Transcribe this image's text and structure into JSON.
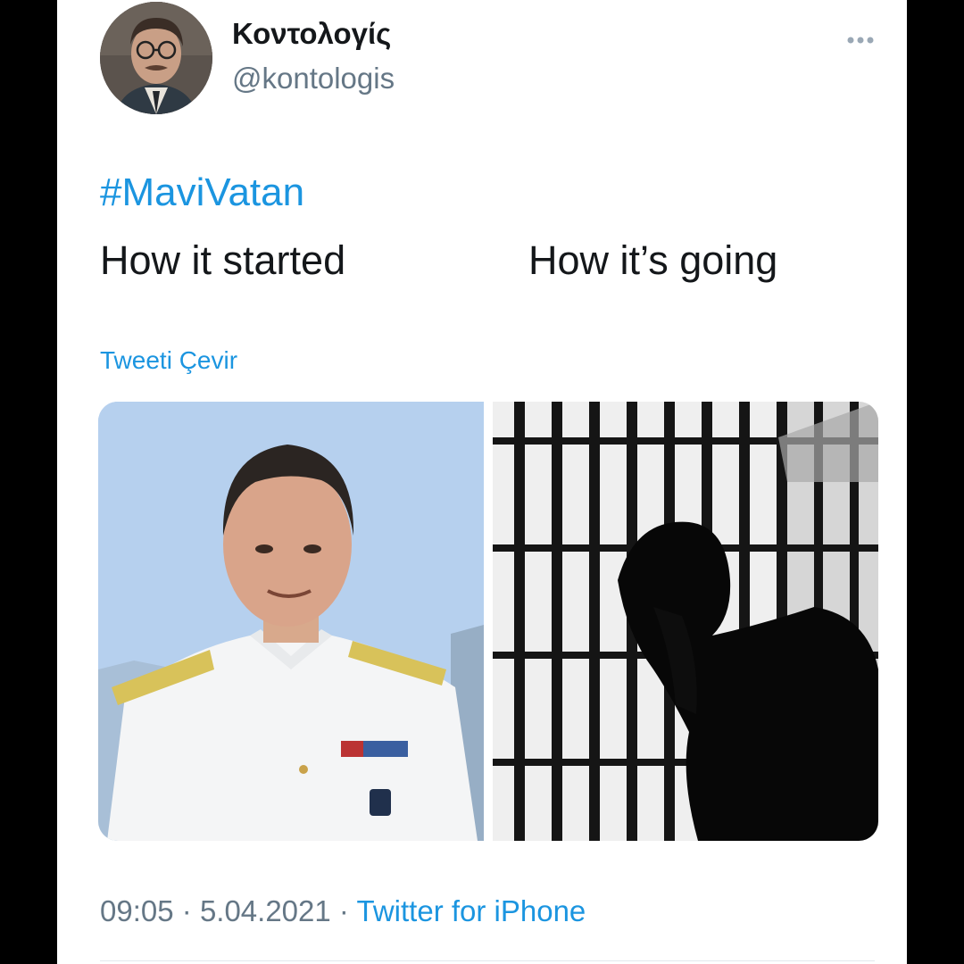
{
  "tweet": {
    "author_name": "Κοντολογίς",
    "author_handle": "@kontologis",
    "more_icon": "more-horizontal-icon",
    "hashtag": "#MaviVatan",
    "text_left": "How it started",
    "text_right": "How it’s going",
    "translate_label": "Tweeti Çevir",
    "media": [
      {
        "name": "navy-officer-photo",
        "description_icon": "photo"
      },
      {
        "name": "prison-bars-photo",
        "description_icon": "photo"
      }
    ],
    "time": "09:05",
    "separator": "·",
    "date": "5.04.2021",
    "source": "Twitter for iPhone"
  },
  "colors": {
    "link": "#1b95e0",
    "text": "#14171a",
    "muted": "#657786"
  }
}
